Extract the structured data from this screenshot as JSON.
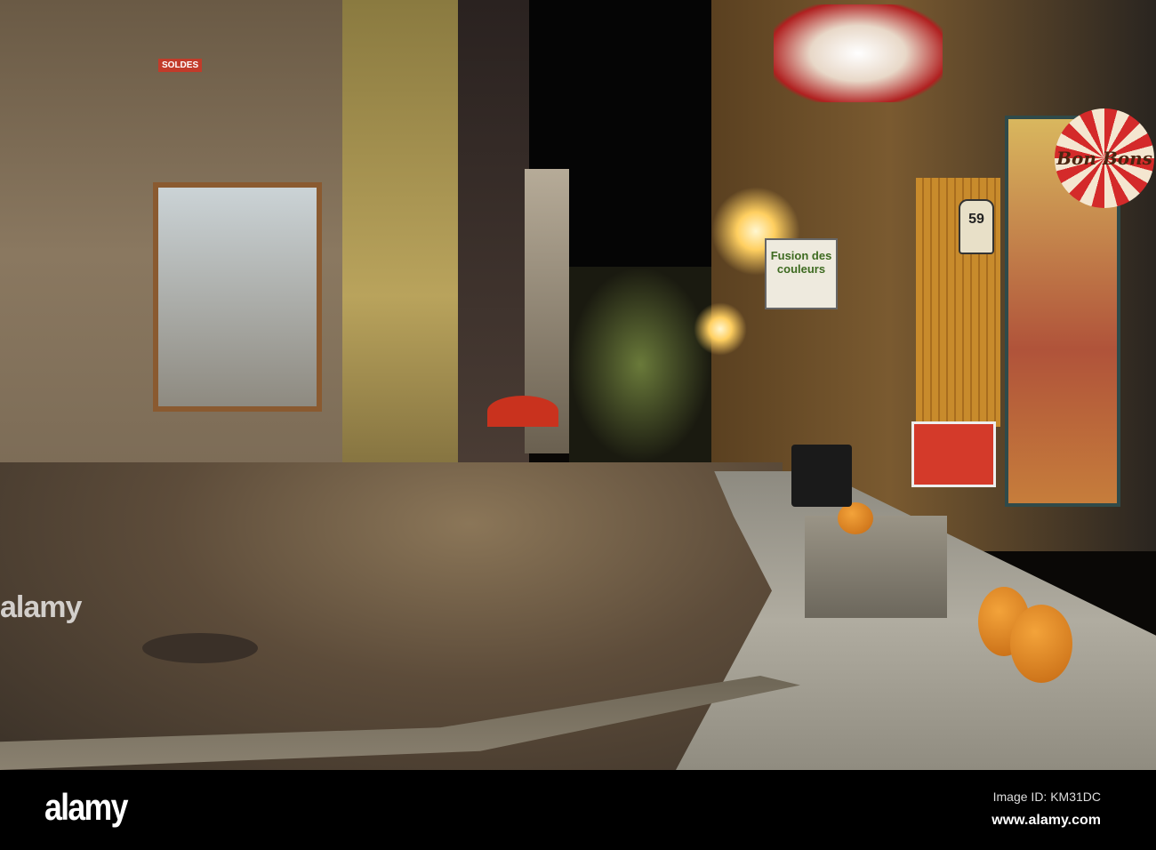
{
  "photo": {
    "signs": {
      "fusion": "Fusion des couleurs",
      "bonbons": "Bon Bons",
      "number": "59",
      "soldes": "SOLDES"
    }
  },
  "watermark": "alamy",
  "footer": {
    "logo": "alamy",
    "image_id": "Image ID: KM31DC",
    "website": "www.alamy.com"
  }
}
